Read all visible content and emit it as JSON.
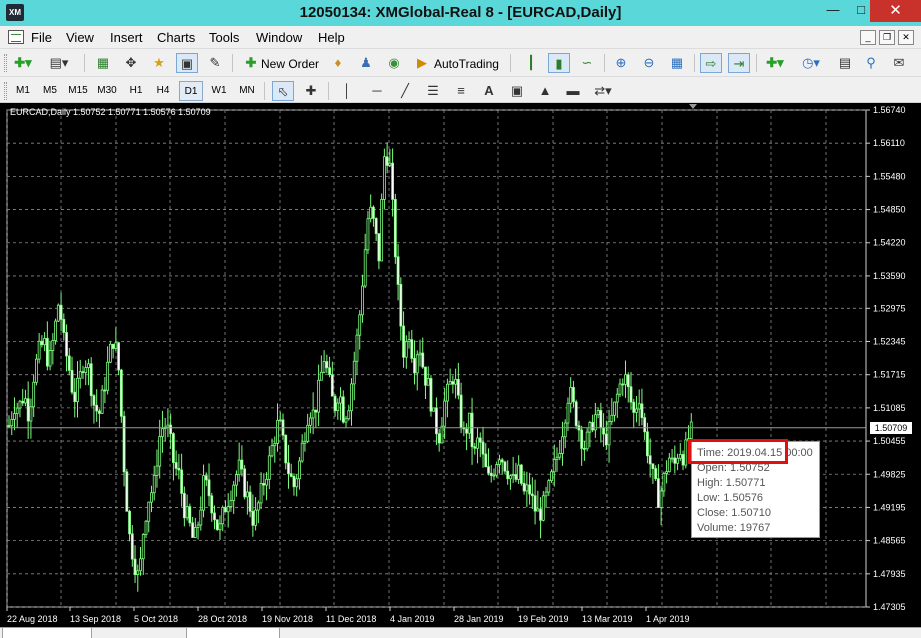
{
  "window": {
    "title": "12050134: XMGlobal-Real 8 - [EURCAD,Daily]",
    "app_icon_text": "XM"
  },
  "menu": [
    "File",
    "View",
    "Insert",
    "Charts",
    "Tools",
    "Window",
    "Help"
  ],
  "toolbar": {
    "new_order_label": "New Order",
    "autotrading_label": "AutoTrading"
  },
  "periods": [
    "M1",
    "M5",
    "M15",
    "M30",
    "H1",
    "H4",
    "D1",
    "W1",
    "MN"
  ],
  "active_period": "D1",
  "chart": {
    "header": "EURCAD,Daily  1.50752 1.50771 1.50576 1.50709",
    "current_price_label": "1.50709"
  },
  "tooltip": {
    "time": "Time: 2019.04.15 00:00",
    "open": "Open: 1.50752",
    "high": "High: 1.50771",
    "low": "Low:  1.50576",
    "close": "Close: 1.50710",
    "volume": "Volume: 19767"
  },
  "colors": {
    "titlebar": "#5ad8d9",
    "candle": "#7cff7c",
    "close_button": "#c9312b",
    "highlight": "#e01010"
  },
  "chart_data": {
    "type": "candlestick",
    "symbol": "EURCAD",
    "timeframe": "Daily",
    "y_ticks": [
      "1.56740",
      "1.56110",
      "1.55480",
      "1.54850",
      "1.54220",
      "1.53590",
      "1.52975",
      "1.52345",
      "1.51715",
      "1.51085",
      "1.50455",
      "1.49825",
      "1.49195",
      "1.48565",
      "1.47935",
      "1.47305"
    ],
    "ylim": [
      1.47305,
      1.5674
    ],
    "x_ticks": [
      "22 Aug 2018",
      "13 Sep 2018",
      "5 Oct 2018",
      "28 Oct 2018",
      "19 Nov 2018",
      "11 Dec 2018",
      "4 Jan 2019",
      "28 Jan 2019",
      "19 Feb 2019",
      "13 Mar 2019",
      "1 Apr 2019"
    ],
    "grid": true,
    "current_price": 1.50709,
    "last_bar": {
      "time": "2019.04.15 00:00",
      "open": 1.50752,
      "high": 1.50771,
      "low": 1.50576,
      "close": 1.5071,
      "volume": 19767
    },
    "close_path": [
      [
        0,
        1.5075
      ],
      [
        5,
        1.5115
      ],
      [
        10,
        1.511
      ],
      [
        15,
        1.5135
      ],
      [
        20,
        1.5095
      ],
      [
        25,
        1.5175
      ],
      [
        30,
        1.5215
      ],
      [
        35,
        1.5235
      ],
      [
        40,
        1.519
      ],
      [
        45,
        1.5245
      ],
      [
        50,
        1.5315
      ],
      [
        55,
        1.523
      ],
      [
        60,
        1.5185
      ],
      [
        65,
        1.5125
      ],
      [
        70,
        1.5155
      ],
      [
        75,
        1.5205
      ],
      [
        80,
        1.518
      ],
      [
        85,
        1.5115
      ],
      [
        90,
        1.5095
      ],
      [
        95,
        1.5145
      ],
      [
        100,
        1.5205
      ],
      [
        105,
        1.5245
      ],
      [
        110,
        1.5175
      ],
      [
        115,
        1.5
      ],
      [
        120,
        1.487
      ],
      [
        125,
        1.482
      ],
      [
        130,
        1.478
      ],
      [
        135,
        1.489
      ],
      [
        140,
        1.494
      ],
      [
        145,
        1.496
      ],
      [
        150,
        1.505
      ],
      [
        155,
        1.508
      ],
      [
        160,
        1.506
      ],
      [
        165,
        1.5
      ],
      [
        170,
        1.498
      ],
      [
        175,
        1.492
      ],
      [
        180,
        1.489
      ],
      [
        185,
        1.485
      ],
      [
        190,
        1.49
      ],
      [
        195,
        1.497
      ],
      [
        200,
        1.4945
      ],
      [
        205,
        1.491
      ],
      [
        210,
        1.487
      ],
      [
        215,
        1.4915
      ],
      [
        220,
        1.494
      ],
      [
        225,
        1.497
      ],
      [
        230,
        1.4995
      ],
      [
        235,
        1.496
      ],
      [
        240,
        1.493
      ],
      [
        245,
        1.489
      ],
      [
        250,
        1.493
      ],
      [
        255,
        1.497
      ],
      [
        260,
        1.5005
      ],
      [
        265,
        1.505
      ],
      [
        270,
        1.5085
      ],
      [
        275,
        1.503
      ],
      [
        280,
        1.4985
      ],
      [
        285,
        1.496
      ],
      [
        290,
        1.5
      ],
      [
        295,
        1.5055
      ],
      [
        300,
        1.511
      ],
      [
        305,
        1.5095
      ],
      [
        310,
        1.5145
      ],
      [
        315,
        1.5205
      ],
      [
        320,
        1.516
      ],
      [
        325,
        1.5105
      ],
      [
        330,
        1.5145
      ],
      [
        335,
        1.509
      ],
      [
        340,
        1.512
      ],
      [
        345,
        1.5195
      ],
      [
        350,
        1.527
      ],
      [
        355,
        1.5385
      ],
      [
        360,
        1.549
      ],
      [
        365,
        1.5455
      ],
      [
        370,
        1.5395
      ],
      [
        375,
        1.5585
      ],
      [
        380,
        1.559
      ],
      [
        385,
        1.5445
      ],
      [
        390,
        1.53
      ],
      [
        395,
        1.521
      ],
      [
        400,
        1.5255
      ],
      [
        405,
        1.519
      ],
      [
        410,
        1.5235
      ],
      [
        415,
        1.5175
      ],
      [
        420,
        1.5145
      ],
      [
        425,
        1.5085
      ],
      [
        430,
        1.5055
      ],
      [
        435,
        1.5115
      ],
      [
        440,
        1.5145
      ],
      [
        445,
        1.5175
      ],
      [
        450,
        1.5105
      ],
      [
        455,
        1.5055
      ],
      [
        460,
        1.5085
      ],
      [
        465,
        1.5015
      ],
      [
        470,
        1.5055
      ],
      [
        475,
        1.5
      ],
      [
        480,
        1.497
      ],
      [
        485,
        1.4995
      ],
      [
        490,
        1.5025
      ],
      [
        495,
        1.5005
      ],
      [
        500,
        1.4985
      ],
      [
        505,
        1.4965
      ],
      [
        510,
        1.4985
      ],
      [
        515,
        1.4945
      ],
      [
        520,
        1.4955
      ],
      [
        525,
        1.492
      ],
      [
        530,
        1.4905
      ],
      [
        535,
        1.4925
      ],
      [
        540,
        1.4955
      ],
      [
        545,
        1.4995
      ],
      [
        550,
        1.503
      ],
      [
        555,
        1.5085
      ],
      [
        560,
        1.5145
      ],
      [
        565,
        1.5105
      ],
      [
        570,
        1.507
      ],
      [
        575,
        1.5035
      ],
      [
        580,
        1.5055
      ],
      [
        585,
        1.5095
      ],
      [
        590,
        1.5085
      ],
      [
        595,
        1.5045
      ],
      [
        600,
        1.5065
      ],
      [
        605,
        1.5105
      ],
      [
        610,
        1.5145
      ],
      [
        615,
        1.5175
      ],
      [
        620,
        1.5135
      ],
      [
        625,
        1.5095
      ],
      [
        630,
        1.5135
      ],
      [
        635,
        1.5065
      ],
      [
        640,
        1.5015
      ],
      [
        645,
        1.4965
      ],
      [
        650,
        1.4935
      ],
      [
        655,
        1.4975
      ],
      [
        660,
        1.5015
      ],
      [
        665,
        1.4995
      ],
      [
        670,
        1.5035
      ],
      [
        675,
        1.5015
      ],
      [
        680,
        1.5055
      ],
      [
        685,
        1.5071
      ]
    ]
  }
}
